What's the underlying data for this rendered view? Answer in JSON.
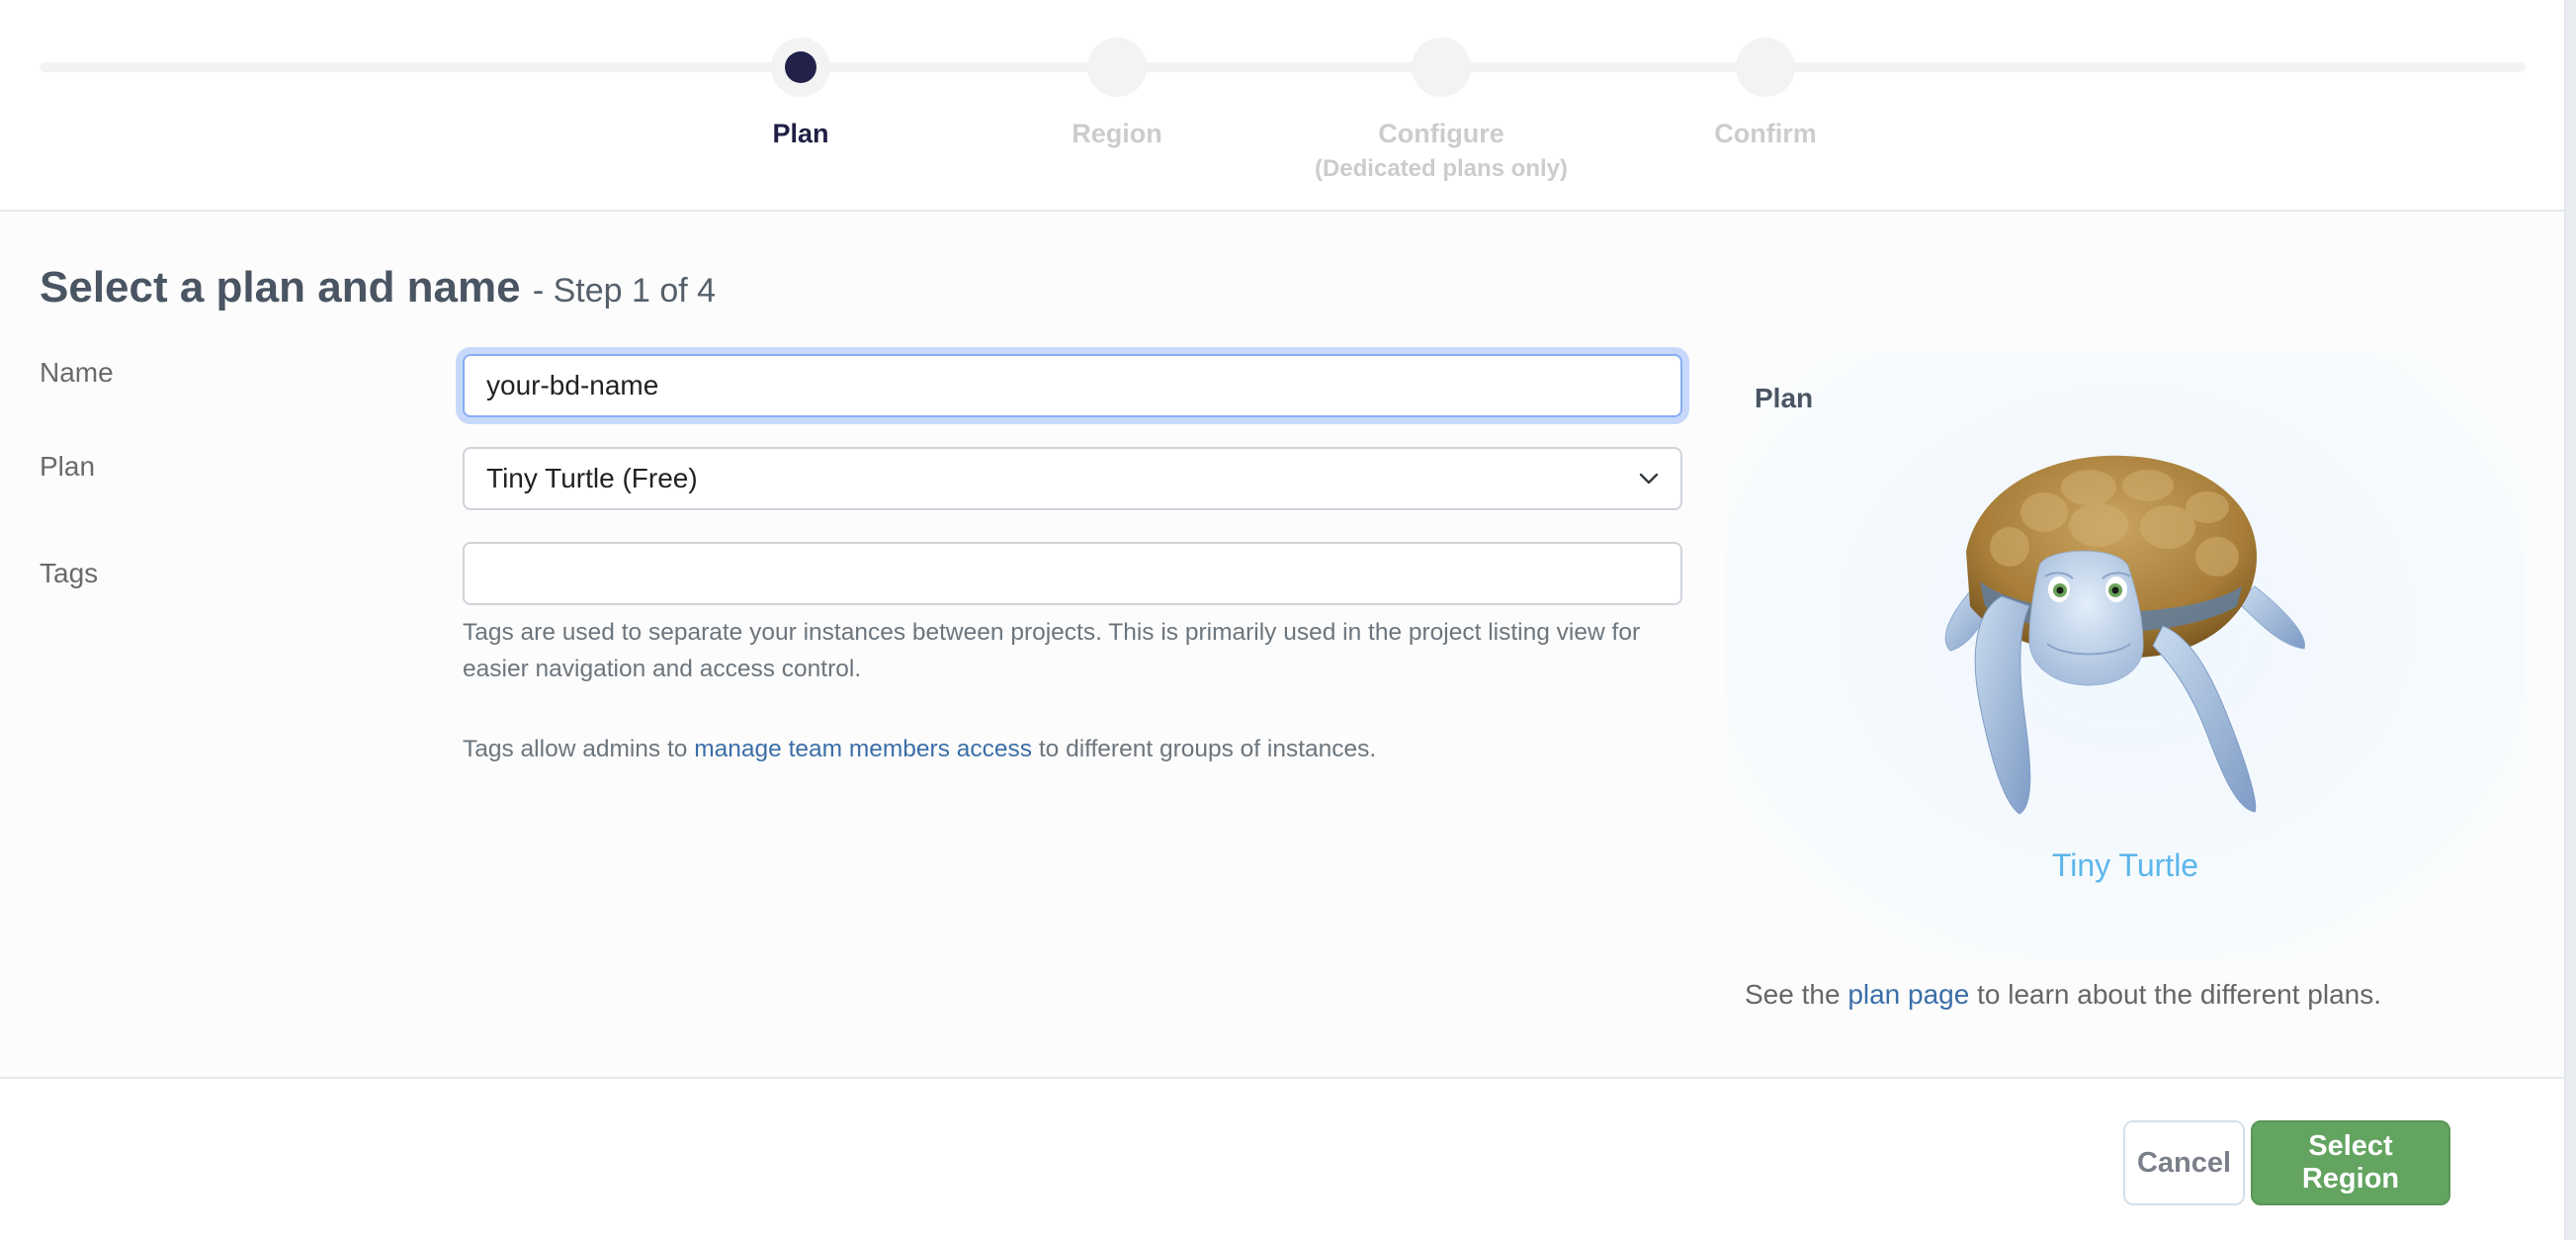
{
  "stepper": {
    "steps": [
      {
        "label": "Plan",
        "sublabel": "",
        "state": "active"
      },
      {
        "label": "Region",
        "sublabel": "",
        "state": "upcoming"
      },
      {
        "label": "Configure",
        "sublabel": "(Dedicated plans only)",
        "state": "upcoming"
      },
      {
        "label": "Confirm",
        "sublabel": "",
        "state": "upcoming"
      }
    ]
  },
  "page": {
    "title": "Select a plan and name",
    "step_indicator": "- Step 1 of 4"
  },
  "form": {
    "name": {
      "label": "Name",
      "value": "your-bd-name",
      "placeholder": ""
    },
    "plan": {
      "label": "Plan",
      "selected": "Tiny Turtle (Free)"
    },
    "tags": {
      "label": "Tags",
      "value": "",
      "help_text": "Tags are used to separate your instances between projects. This is primarily used in the project listing view for easier navigation and access control.",
      "admin_text_before": "Tags allow admins to",
      "admin_link": "manage team members access",
      "admin_text_after": "to different groups of instances."
    }
  },
  "plan_card": {
    "title": "Plan",
    "plan_name": "Tiny Turtle",
    "image": "tiny-turtle-mascot",
    "note_before": "See the",
    "note_link": "plan page",
    "note_after": "to learn about the different plans."
  },
  "footer": {
    "cancel_label": "Cancel",
    "primary_label": "Select Region",
    "primary_color": "#63a461"
  },
  "colors": {
    "active_step": "#22214a",
    "inactive_step": "#cccccc",
    "link": "#3b6ea8",
    "plan_name": "#5bb6ea",
    "focus_ring": "#c7d8fb"
  }
}
